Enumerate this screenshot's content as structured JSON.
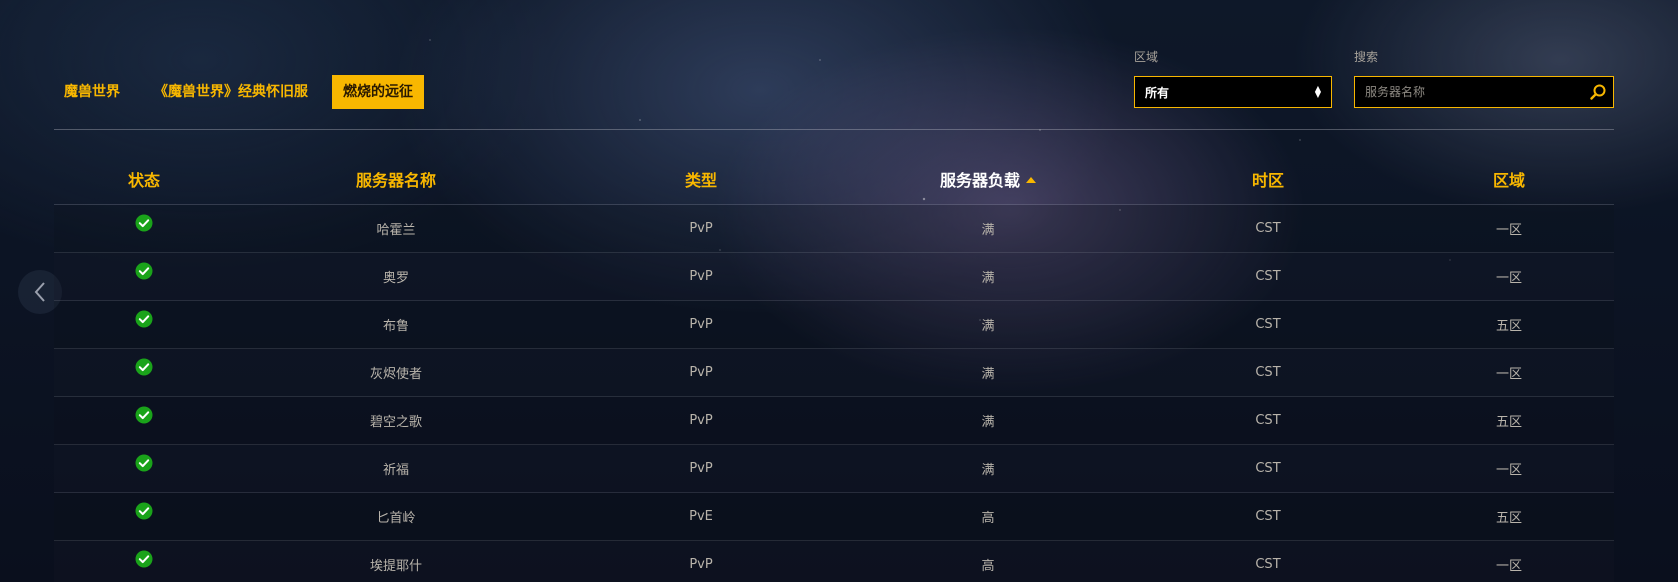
{
  "colors": {
    "accent": "#f8b700",
    "status_ok": "#1aa31a",
    "text": "#b9b4ab"
  },
  "tabs": [
    {
      "label": "魔兽世界",
      "active": false
    },
    {
      "label": "《魔兽世界》经典怀旧服",
      "active": false
    },
    {
      "label": "燃烧的远征",
      "active": true
    }
  ],
  "filters": {
    "region_label": "区域",
    "region_value": "所有",
    "search_label": "搜索",
    "search_placeholder": "服务器名称",
    "search_icon": "search-icon"
  },
  "table": {
    "headers": {
      "status": "状态",
      "name": "服务器名称",
      "type": "类型",
      "load": "服务器负载",
      "timezone": "时区",
      "region": "区域"
    },
    "sorted_column": "load",
    "rows": [
      {
        "status": "online",
        "name": "哈霍兰",
        "type": "PvP",
        "load": "满",
        "timezone": "CST",
        "region": "一区"
      },
      {
        "status": "online",
        "name": "奥罗",
        "type": "PvP",
        "load": "满",
        "timezone": "CST",
        "region": "一区"
      },
      {
        "status": "online",
        "name": "布鲁",
        "type": "PvP",
        "load": "满",
        "timezone": "CST",
        "region": "五区"
      },
      {
        "status": "online",
        "name": "灰烬使者",
        "type": "PvP",
        "load": "满",
        "timezone": "CST",
        "region": "一区"
      },
      {
        "status": "online",
        "name": "碧空之歌",
        "type": "PvP",
        "load": "满",
        "timezone": "CST",
        "region": "五区"
      },
      {
        "status": "online",
        "name": "祈福",
        "type": "PvP",
        "load": "满",
        "timezone": "CST",
        "region": "一区"
      },
      {
        "status": "online",
        "name": "匕首岭",
        "type": "PvE",
        "load": "高",
        "timezone": "CST",
        "region": "五区"
      },
      {
        "status": "online",
        "name": "埃提耶什",
        "type": "PvP",
        "load": "高",
        "timezone": "CST",
        "region": "一区"
      }
    ]
  }
}
